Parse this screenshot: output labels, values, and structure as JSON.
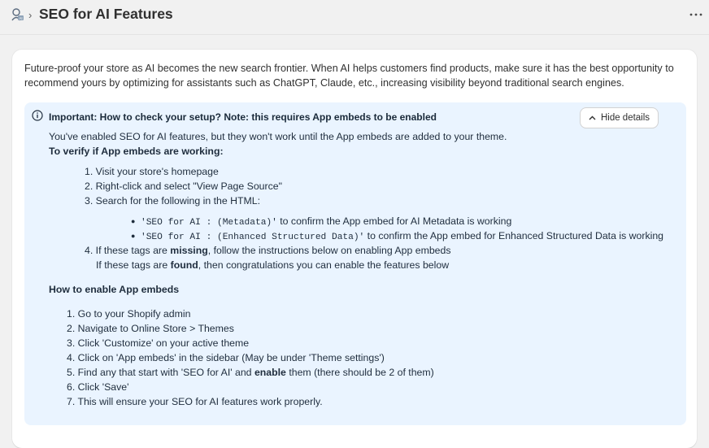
{
  "header": {
    "title": "SEO for AI Features",
    "breadcrumb_separator": "›",
    "more_icon": "ellipsis-icon"
  },
  "intro": "Future-proof your store as AI becomes the new search frontier. When AI helps customers find products, make sure it has the best opportunity to recommend yours by optimizing for assistants such as ChatGPT, Claude, etc., increasing visibility beyond traditional search engines.",
  "banner": {
    "title": "Important: How to check your setup? Note: this requires App embeds to be enabled",
    "hide_label": "Hide details",
    "enabled_text": "You've enabled SEO for AI features, but they won't work until the App embeds are added to your theme.",
    "verify_heading": "To verify if App embeds are working:",
    "verify_steps": [
      "1. Visit your store's homepage",
      "2. Right-click and select \"View Page Source\"",
      "3. Search for the following in the HTML:"
    ],
    "tags": [
      {
        "code": "'SEO for AI : (Metadata)'",
        "text": " to confirm the App embed for AI Metadata is working"
      },
      {
        "code": "'SEO for AI : (Enhanced Structured Data)'",
        "text": " to confirm the App embed for Enhanced Structured Data is working"
      }
    ],
    "step4_prefix": "4. If these tags are ",
    "step4_bold": "missing",
    "step4_suffix": ", follow the instructions below on enabling App embeds",
    "found_prefix": "If these tags are ",
    "found_bold": "found",
    "found_suffix": ", then congratulations you can enable the features below",
    "enable_heading": "How to enable App embeds",
    "enable_steps": [
      "1. Go to your Shopify admin",
      "2. Navigate to Online Store > Themes",
      "3. Click 'Customize' on your active theme",
      "4. Click on 'App embeds' in the sidebar (May be under 'Theme settings')"
    ],
    "step5_prefix": "5. Find any that start with 'SEO for AI' and ",
    "step5_bold": "enable",
    "step5_suffix": " them (there should be 2 of them)",
    "enable_steps_end": [
      "6. Click 'Save'",
      "7. This will ensure your SEO for AI features work properly."
    ]
  },
  "colors": {
    "page_bg": "#f1f1f1",
    "card_bg": "#ffffff",
    "banner_bg": "#eaf4ff"
  }
}
